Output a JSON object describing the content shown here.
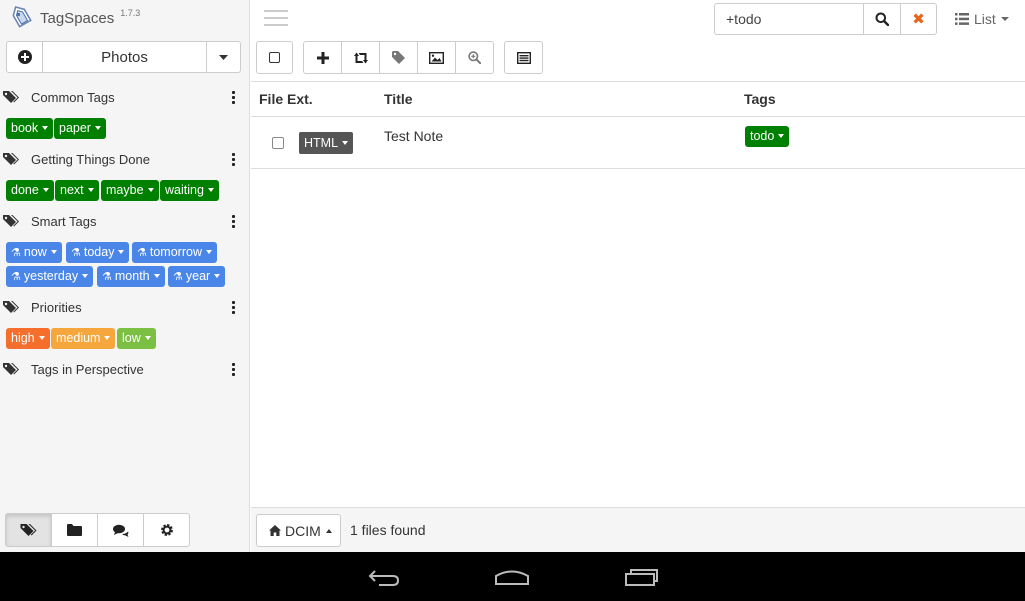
{
  "app": {
    "name": "TagSpaces",
    "version": "1.7.3"
  },
  "perspective": {
    "name": "Photos"
  },
  "tag_groups": [
    {
      "title": "Common Tags",
      "tags": [
        "book",
        "paper"
      ]
    },
    {
      "title": "Getting Things Done",
      "tags": [
        "done",
        "next",
        "maybe",
        "waiting"
      ]
    },
    {
      "title": "Smart Tags",
      "tags": [
        "now",
        "today",
        "tomorrow",
        "yesterday",
        "month",
        "year"
      ]
    },
    {
      "title": "Priorities",
      "tags": [
        "high",
        "medium",
        "low"
      ]
    },
    {
      "title": "Tags in Perspective",
      "tags": []
    }
  ],
  "tag_colors": {
    "green": "#008000",
    "smart": "#4a86e8",
    "high": "#f66e2b",
    "medium": "#f5a63c",
    "low": "#7bc043"
  },
  "search": {
    "value": "+todo"
  },
  "view_switch": {
    "label": "List"
  },
  "table": {
    "columns": [
      "File Ext.",
      "Title",
      "Tags"
    ],
    "rows": [
      {
        "ext": "HTML",
        "title": "Test Note",
        "tags": [
          "todo"
        ]
      }
    ]
  },
  "status": {
    "location": "DCIM",
    "found_text": "1 files found"
  },
  "toolbar_icons": [
    "select-all-checkbox",
    "plus-icon",
    "retweet-icon",
    "tag-icon",
    "image-icon",
    "zoom-in-icon",
    "list-alt-icon"
  ],
  "sidebar_bottom_icons": [
    "tags-icon",
    "folder-icon",
    "comments-icon",
    "gear-icon"
  ]
}
